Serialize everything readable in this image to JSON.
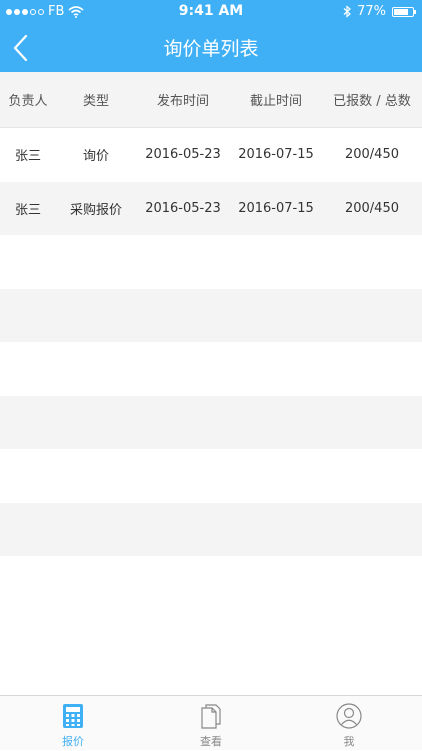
{
  "status_bar": {
    "carrier": "FB",
    "time": "9:41 AM",
    "battery": "77%",
    "battery_level": 0.77
  },
  "nav": {
    "title": "询价单列表"
  },
  "table": {
    "headers": [
      "负责人",
      "类型",
      "发布时间",
      "截止时间",
      "已报数 / 总数"
    ],
    "rows": [
      [
        "张三",
        "询价",
        "2016-05-23",
        "2016-07-15",
        "200/450"
      ],
      [
        "张三",
        "采购报价",
        "2016-05-23",
        "2016-07-15",
        "200/450"
      ]
    ]
  },
  "tabbar": {
    "items": [
      {
        "label": "报价",
        "icon": "calculator-icon",
        "active": true
      },
      {
        "label": "查看",
        "icon": "document-icon",
        "active": false
      },
      {
        "label": "我",
        "icon": "user-icon",
        "active": false
      }
    ]
  },
  "colors": {
    "primary": "#3fb0f5",
    "row_alt": "#f4f4f4"
  }
}
